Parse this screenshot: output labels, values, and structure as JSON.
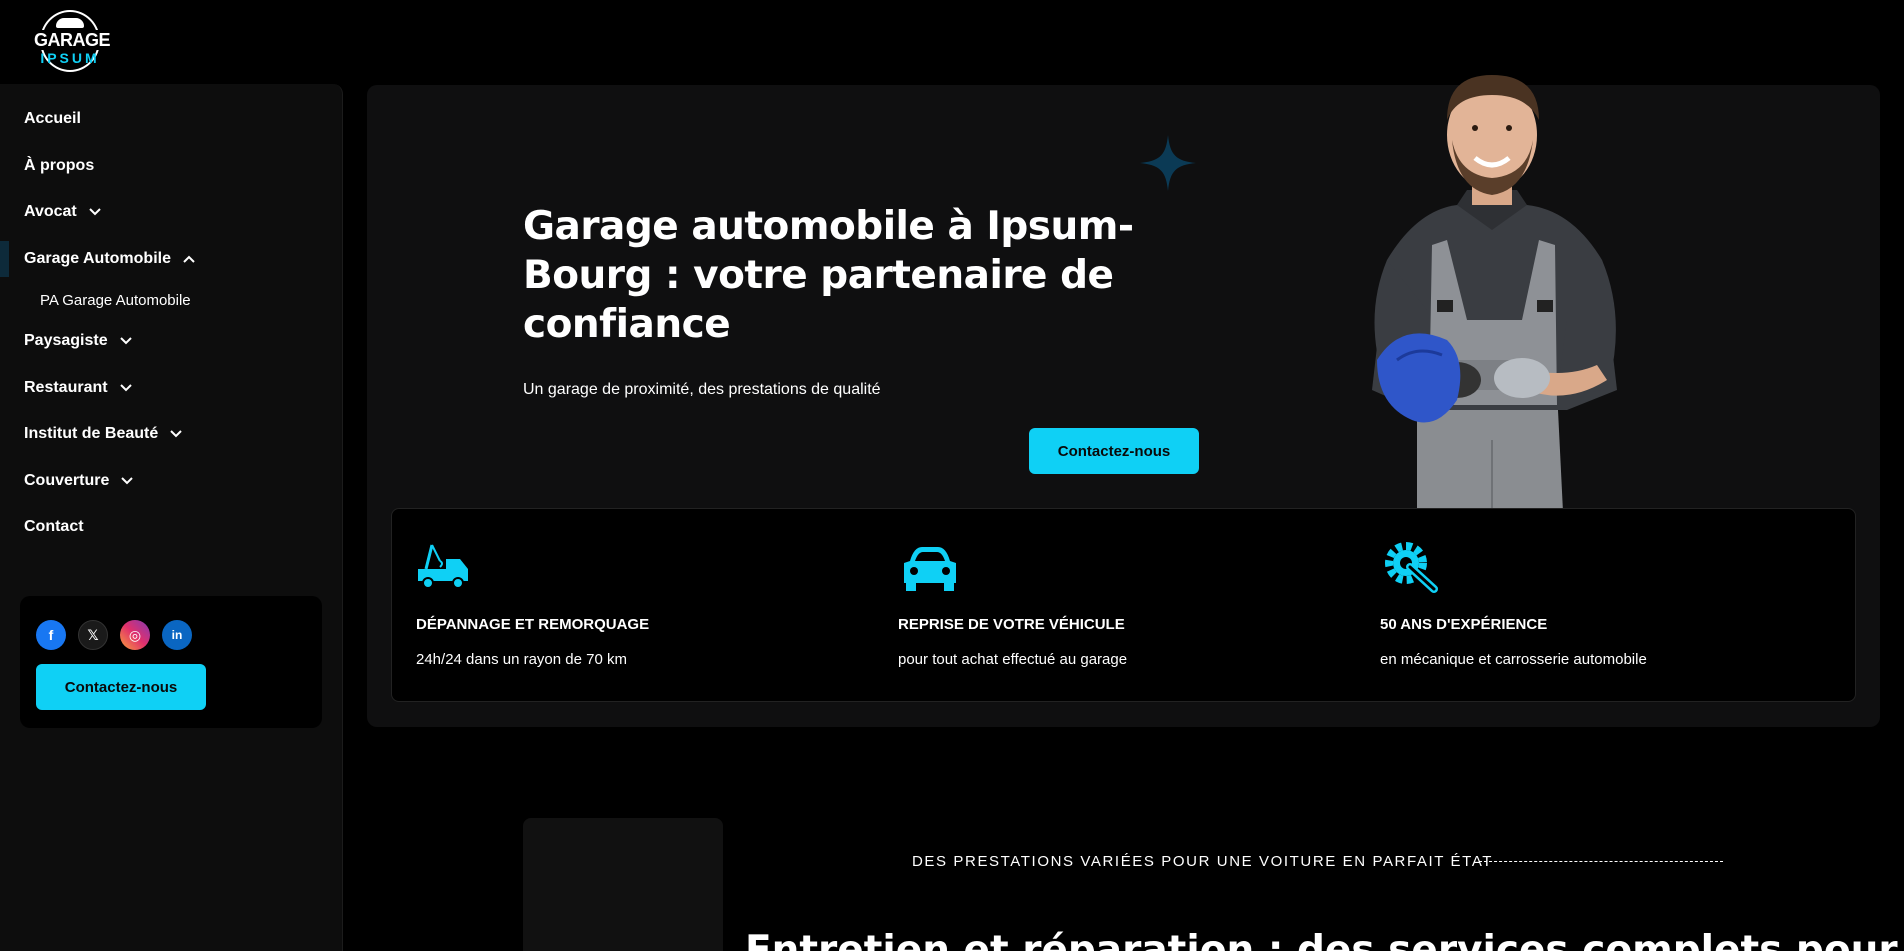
{
  "logo": {
    "line1": "GARAGE",
    "line2": "IPSUM"
  },
  "nav": {
    "items": [
      {
        "label": "Accueil",
        "chevron": ""
      },
      {
        "label": "À propos",
        "chevron": ""
      },
      {
        "label": "Avocat",
        "chevron": "⌄"
      },
      {
        "label": "Garage Automobile",
        "chevron": "⌃"
      },
      {
        "label": "Paysagiste",
        "chevron": "⌄"
      },
      {
        "label": "Restaurant",
        "chevron": "⌄"
      },
      {
        "label": "Institut de Beauté",
        "chevron": "⌄"
      },
      {
        "label": "Couverture",
        "chevron": "⌄"
      },
      {
        "label": "Contact",
        "chevron": ""
      }
    ],
    "sub_item": "PA Garage Automobile"
  },
  "sidebar_box": {
    "socials": {
      "facebook": "f",
      "x": "𝕏",
      "instagram": "◎",
      "linkedin": "in"
    },
    "button": "Contactez-nous"
  },
  "hero": {
    "title": "Garage automobile à Ipsum-Bourg : votre partenaire de confiance",
    "subtitle": "Un garage de proximité, des prestations de qualité",
    "button": "Contactez-nous"
  },
  "features": [
    {
      "icon": "tow-truck-icon",
      "title": "DÉPANNAGE ET REMORQUAGE",
      "desc": "24h/24 dans un rayon de 70 km"
    },
    {
      "icon": "car-icon",
      "title": "REPRISE DE VOTRE VÉHICULE",
      "desc": "pour tout achat effectué au garage"
    },
    {
      "icon": "gear-wrench-icon",
      "title": "50 ANS D'EXPÉRIENCE",
      "desc": "en mécanique et carrosserie automobile"
    }
  ],
  "lower": {
    "kicker": "DES PRESTATIONS VARIÉES POUR UNE VOITURE EN PARFAIT ÉTAT",
    "title": "Entretien et réparation : des services complets pour"
  },
  "colors": {
    "accent": "#0fd0f5",
    "panel": "#0f0f10",
    "sidebar": "#0d0d0d"
  }
}
